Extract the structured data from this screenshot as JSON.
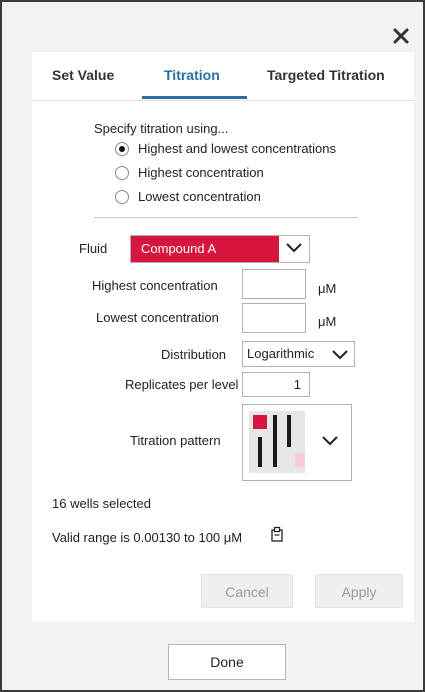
{
  "tabs": [
    {
      "label": "Set Value",
      "active": false
    },
    {
      "label": "Titration",
      "active": true
    },
    {
      "label": "Targeted Titration",
      "active": false
    }
  ],
  "specify": {
    "heading": "Specify titration using...",
    "options": [
      {
        "label": "Highest and lowest concentrations",
        "checked": true
      },
      {
        "label": "Highest concentration",
        "checked": false
      },
      {
        "label": "Lowest concentration",
        "checked": false
      }
    ]
  },
  "fluid": {
    "label": "Fluid",
    "value": "Compound A",
    "color": "#d7163f"
  },
  "highest": {
    "label": "Highest concentration",
    "value": "",
    "unit": "μM"
  },
  "lowest": {
    "label": "Lowest concentration",
    "value": "",
    "unit": "μM"
  },
  "distribution": {
    "label": "Distribution",
    "value": "Logarithmic"
  },
  "replicates": {
    "label": "Replicates per level",
    "value": "1"
  },
  "pattern": {
    "label": "Titration pattern",
    "icon": "titration-pattern-icon"
  },
  "status": {
    "wells_selected": "16 wells selected",
    "valid_range": "Valid range is 0.00130 to 100 μM"
  },
  "buttons": {
    "cancel": "Cancel",
    "apply": "Apply",
    "done": "Done"
  },
  "icons": {
    "close": "close-icon",
    "copy": "clipboard-icon",
    "chevron": "chevron-down-icon"
  }
}
